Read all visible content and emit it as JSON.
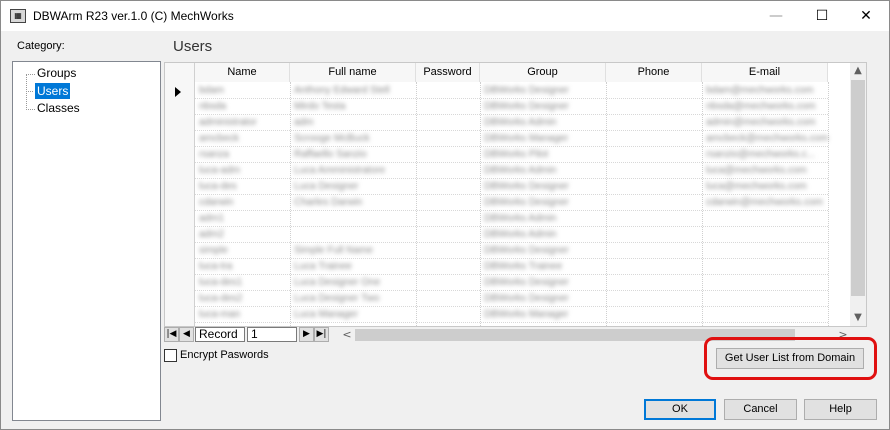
{
  "window": {
    "title": "DBWArm R23 ver.1.0 (C) MechWorks",
    "icon": "app-icon",
    "controls": {
      "minimize": "—",
      "maximize": "☐",
      "close": "✕"
    }
  },
  "category": {
    "label": "Category:",
    "items": [
      {
        "label": "Groups",
        "selected": false
      },
      {
        "label": "Users",
        "selected": true
      },
      {
        "label": "Classes",
        "selected": false
      }
    ]
  },
  "panel": {
    "title": "Users"
  },
  "grid": {
    "columns": [
      "Name",
      "Full name",
      "Password",
      "Group",
      "Phone",
      "E-mail"
    ],
    "rows": [
      [
        "bdam",
        "Anthony Edward Stell",
        "",
        "DBWorks Designer",
        "",
        "bdam@mechworks.com"
      ],
      [
        "nbsda",
        "Mirdo Testa",
        "",
        "DBWorks Designer",
        "",
        "nbsda@mechworks.com"
      ],
      [
        "administrator",
        "adm",
        "",
        "DBWorks Admin",
        "",
        "admin@mechworks.com"
      ],
      [
        "amcbeck",
        "Scrooge McBuck",
        "",
        "DBWorks Manager",
        "",
        "amcbeck@mechworks.com"
      ],
      [
        "rsanza",
        "Raffaello Sanzio",
        "",
        "DBWorks Pilot",
        "",
        "rsanzio@mechworks.c..."
      ],
      [
        "luca-adm",
        "Luca Amministratore",
        "",
        "DBWorks Admin",
        "",
        "luca@mechworks.com"
      ],
      [
        "luca-des",
        "Luca Designer",
        "",
        "DBWorks Designer",
        "",
        "luca@mechworks.com"
      ],
      [
        "cdarwin",
        "Charles Darwin",
        "",
        "DBWorks Designer",
        "",
        "cdarwin@mechworks.com"
      ],
      [
        "adm1",
        "",
        "",
        "DBWorks Admin",
        "",
        ""
      ],
      [
        "adm2",
        "",
        "",
        "DBWorks Admin",
        "",
        ""
      ],
      [
        "simple",
        "Simple Full Name",
        "",
        "DBWorks Designer",
        "",
        ""
      ],
      [
        "luca-tra",
        "Luca Trainee",
        "",
        "DBWorks Trainee",
        "",
        ""
      ],
      [
        "luca-des1",
        "Luca Designer One",
        "",
        "DBWorks Designer",
        "",
        ""
      ],
      [
        "luca-des2",
        "Luca Designer Two",
        "",
        "DBWorks Designer",
        "",
        ""
      ],
      [
        "luca-man",
        "Luca Manager",
        "",
        "DBWorks Manager",
        "",
        ""
      ]
    ]
  },
  "navigator": {
    "record_label": "Record",
    "record_value": "1",
    "first": "|◀",
    "prev": "◀",
    "next": "▶",
    "last": "▶|"
  },
  "encrypt": {
    "label": "Encrypt Paswords",
    "checked": false
  },
  "buttons": {
    "domain": "Get User List from Domain",
    "ok": "OK",
    "cancel": "Cancel",
    "help": "Help"
  },
  "colors": {
    "selection": "#0078d7",
    "highlight": "#e01010"
  }
}
